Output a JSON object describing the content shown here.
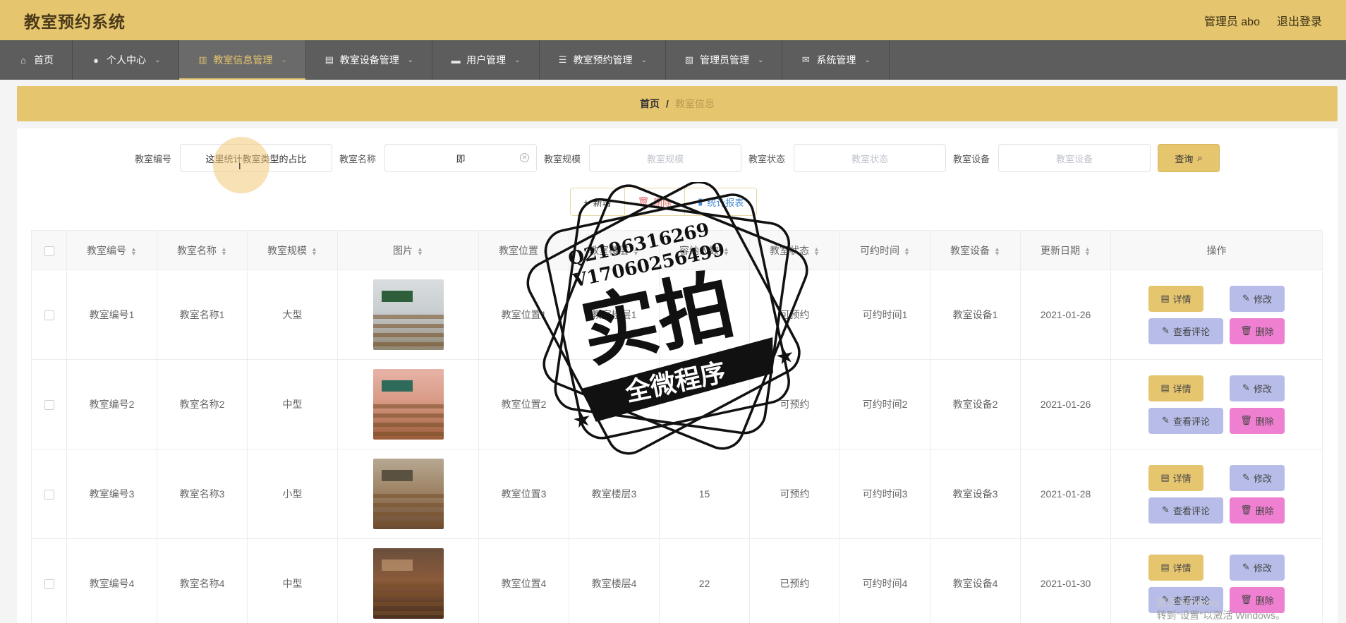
{
  "header": {
    "title": "教室预约系统",
    "user": "管理员 abo",
    "logout": "退出登录"
  },
  "nav": [
    {
      "label": "首页",
      "icon": "home-icon",
      "glyph": "⌂"
    },
    {
      "label": "个人中心",
      "icon": "user-icon",
      "glyph": "●"
    },
    {
      "label": "教室信息管理",
      "icon": "bar-chart-icon",
      "glyph": "▥",
      "active": true
    },
    {
      "label": "教室设备管理",
      "icon": "building-icon",
      "glyph": "▤"
    },
    {
      "label": "用户管理",
      "icon": "printer-icon",
      "glyph": "▬"
    },
    {
      "label": "教室预约管理",
      "icon": "list-icon",
      "glyph": "☰"
    },
    {
      "label": "管理员管理",
      "icon": "chart-icon",
      "glyph": "▧"
    },
    {
      "label": "系统管理",
      "icon": "mail-icon",
      "glyph": "✉"
    }
  ],
  "breadcrumb": {
    "home": "首页",
    "sep": "/",
    "current": "教室信息"
  },
  "search": {
    "f1_label": "教室编号",
    "f1_value": "这里统计教室类型的占比",
    "f2_label": "教室名称",
    "f2_value": "即",
    "f3_label": "教室规模",
    "f3_placeholder": "教室规模",
    "f4_label": "教室状态",
    "f4_placeholder": "教室状态",
    "f5_label": "教室设备",
    "f5_placeholder": "教室设备",
    "query": "查询"
  },
  "actions": {
    "add": "新增",
    "delete": "删除",
    "stats": "统计报表"
  },
  "table": {
    "headers": [
      "教室编号",
      "教室名称",
      "教室规模",
      "图片",
      "教室位置",
      "教室楼层",
      "容纳人数",
      "教室状态",
      "可约时间",
      "教室设备",
      "更新日期",
      "操作"
    ],
    "rows": [
      [
        "教室编号1",
        "教室名称1",
        "大型",
        "",
        "教室位置1",
        "教室楼层1",
        "",
        "可预约",
        "可约时间1",
        "教室设备1",
        "2021-01-26"
      ],
      [
        "教室编号2",
        "教室名称2",
        "中型",
        "",
        "教室位置2",
        "教室楼层2",
        "",
        "可预约",
        "可约时间2",
        "教室设备2",
        "2021-01-26"
      ],
      [
        "教室编号3",
        "教室名称3",
        "小型",
        "",
        "教室位置3",
        "教室楼层3",
        "15",
        "可预约",
        "可约时间3",
        "教室设备3",
        "2021-01-28"
      ],
      [
        "教室编号4",
        "教室名称4",
        "中型",
        "",
        "教室位置4",
        "教室楼层4",
        "22",
        "已预约",
        "可约时间4",
        "教室设备4",
        "2021-01-30"
      ]
    ],
    "ops": {
      "detail": "详情",
      "edit": "修改",
      "review": "查看评论",
      "delete": "删除"
    }
  },
  "watermark": {
    "line1": "Q2196316269",
    "line2": "V17060256499",
    "main": "实拍",
    "ribbon": "全微程序"
  },
  "os_notice": {
    "line1": "激活 Windows",
    "line2": "转到\"设置\"以激活 Windows。"
  }
}
